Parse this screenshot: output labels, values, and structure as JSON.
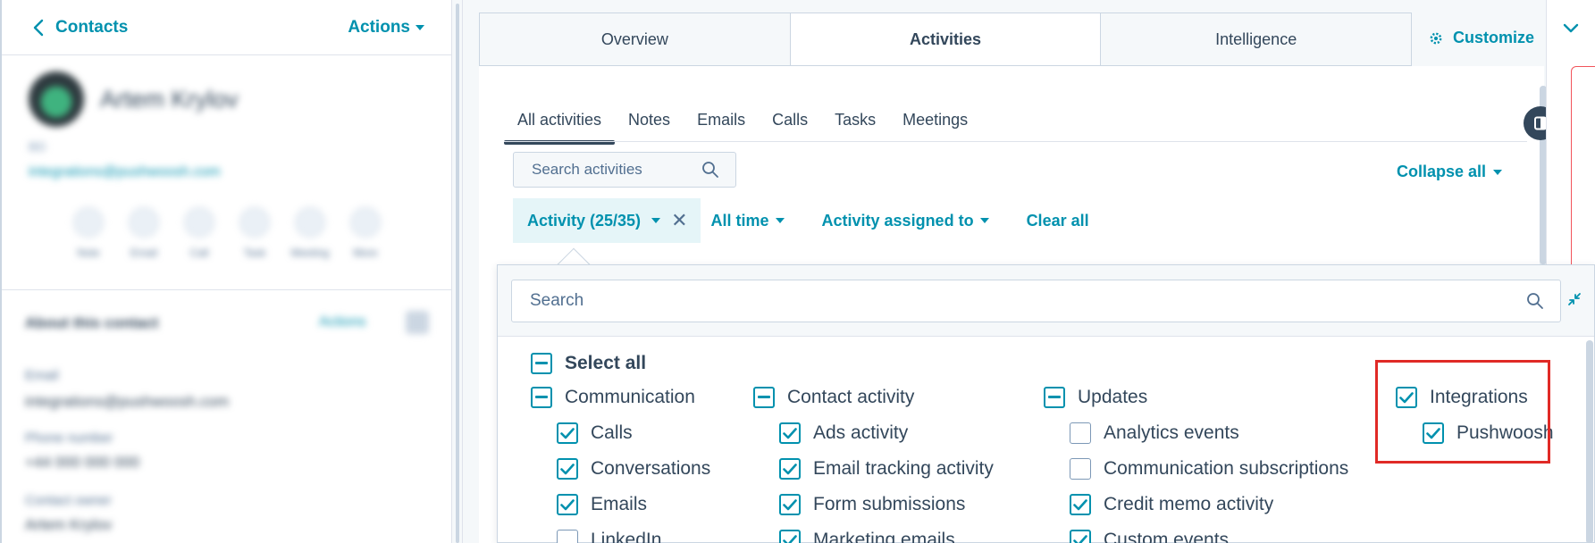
{
  "header": {
    "back_label": "Contacts",
    "actions_label": "Actions"
  },
  "contact": {
    "name": "Artem Krylov",
    "subtitle": "BD",
    "email": "integrations@pushwoosh.com",
    "quick_actions": [
      "Note",
      "Email",
      "Call",
      "Task",
      "Meeting",
      "More"
    ],
    "about_title": "About this contact",
    "about_actions": "Actions",
    "fields": [
      {
        "label": "Email",
        "value": "integrations@pushwoosh.com"
      },
      {
        "label": "Phone number",
        "value": "+44 000 000 000"
      },
      {
        "label": "Contact owner",
        "value": "Artem Krylov"
      }
    ]
  },
  "record_tabs": [
    "Overview",
    "Activities",
    "Intelligence"
  ],
  "active_record_tab": "Activities",
  "customize_label": "Customize",
  "activity_tabs": [
    "All activities",
    "Notes",
    "Emails",
    "Calls",
    "Tasks",
    "Meetings"
  ],
  "active_activity_tab": "All activities",
  "search_activities_placeholder": "Search activities",
  "collapse_all_label": "Collapse all",
  "filters": {
    "activity": "Activity (25/35)",
    "time": "All time",
    "assigned": "Activity assigned to",
    "clear": "Clear all"
  },
  "dropdown": {
    "search_placeholder": "Search",
    "select_all": "Select all",
    "groups": [
      {
        "label": "Communication",
        "state": "mixed",
        "items": [
          {
            "label": "Calls",
            "checked": true
          },
          {
            "label": "Conversations",
            "checked": true
          },
          {
            "label": "Emails",
            "checked": true
          },
          {
            "label": "LinkedIn",
            "checked": false
          }
        ]
      },
      {
        "label": "Contact activity",
        "state": "mixed",
        "items": [
          {
            "label": "Ads activity",
            "checked": true
          },
          {
            "label": "Email tracking activity",
            "checked": true
          },
          {
            "label": "Form submissions",
            "checked": true
          },
          {
            "label": "Marketing emails",
            "checked": true
          }
        ]
      },
      {
        "label": "Updates",
        "state": "mixed",
        "items": [
          {
            "label": "Analytics events",
            "checked": false
          },
          {
            "label": "Communication subscriptions",
            "checked": false
          },
          {
            "label": "Credit memo activity",
            "checked": true
          },
          {
            "label": "Custom events",
            "checked": true
          }
        ]
      },
      {
        "label": "Integrations",
        "state": "checked",
        "items": [
          {
            "label": "Pushwoosh",
            "checked": true
          }
        ]
      }
    ]
  },
  "colors": {
    "accent": "#0091ae",
    "text": "#33475b",
    "highlight": "#e02a26",
    "chip_bg": "#e5f5f8"
  }
}
